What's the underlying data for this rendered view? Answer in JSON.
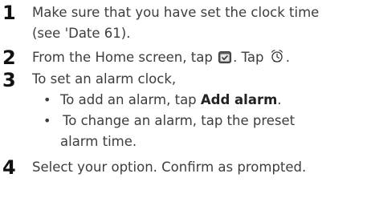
{
  "steps": [
    {
      "number": "1",
      "lines": [
        "Make sure that you have set the clock time",
        "(see 'Date 61)."
      ]
    },
    {
      "number": "2",
      "text_a": "From the Home screen, tap",
      "text_b": ". Tap",
      "text_c": ".",
      "icons": [
        "calendar-check-icon",
        "alarm-clock-icon"
      ]
    },
    {
      "number": "3",
      "intro": "To set an alarm clock,",
      "bullets": [
        {
          "text_a": "To add an alarm, tap ",
          "bold": "Add alarm",
          "text_b": "."
        },
        {
          "lines": [
            "To change an alarm, tap the preset",
            "alarm time."
          ]
        }
      ]
    },
    {
      "number": "4",
      "text": "Select your option. Confirm as prompted."
    }
  ],
  "bullet_glyph": "•"
}
